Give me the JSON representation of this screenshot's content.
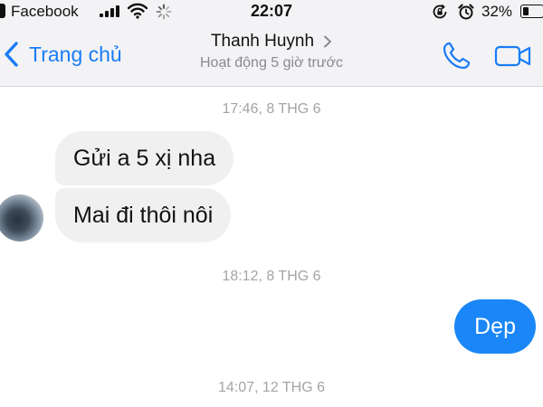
{
  "status_bar": {
    "carrier": "Facebook",
    "time": "22:07",
    "battery_percent": "32%",
    "battery_level": 0.32,
    "icons": [
      "back-to-app-icon",
      "signal-icon",
      "wifi-icon",
      "loading-icon",
      "orientation-lock-icon",
      "alarm-icon",
      "battery-icon"
    ]
  },
  "header": {
    "back_label": "Trang chủ",
    "contact_name": "Thanh Huynh",
    "contact_status": "Hoạt động 5 giờ trước",
    "icons": [
      "chevron-left-icon",
      "chevron-right-icon",
      "phone-icon",
      "video-camera-icon"
    ]
  },
  "conversation": {
    "timestamps": [
      "17:46, 8 THG 6",
      "18:12, 8 THG 6",
      "14:07, 12 THG 6"
    ],
    "incoming": [
      "Gửi a 5 xị nha",
      "Mai đi thôi nôi"
    ],
    "outgoing": [
      "Dẹp"
    ]
  },
  "colors": {
    "accent": "#1a7cf5",
    "outgoing_bubble": "#1a86f7",
    "incoming_bubble": "#f1f0f0",
    "header_background": "#f3f3f5",
    "timestamp_text": "#a4a4a8"
  }
}
